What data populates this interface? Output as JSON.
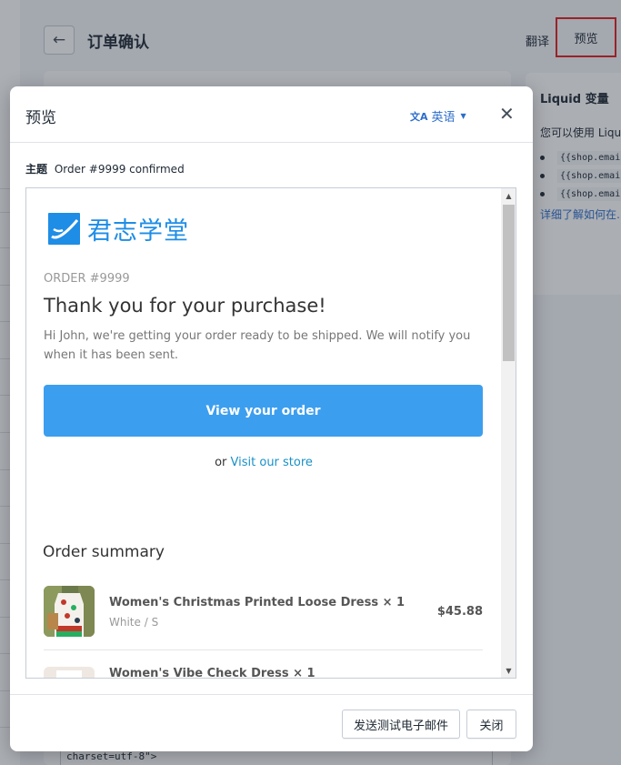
{
  "page": {
    "title": "订单确认",
    "back_icon": "arrow-left-icon",
    "translate_label": "翻译",
    "preview_label": "预览",
    "code_snippet": "charset=utf-8\">"
  },
  "sidebar": {
    "title": "Liquid 变量",
    "description": "您可以使用 Liqu… 强调色和 logo 图… 有:",
    "variables": [
      "{{shop.email",
      "{{shop.email",
      "{{shop.email"
    ],
    "learn_more": "详细了解如何在… Liquid 变量"
  },
  "modal": {
    "title": "预览",
    "language": "英语",
    "subject_label": "主题",
    "subject_value": "Order #9999 confirmed",
    "send_test_label": "发送测试电子邮件",
    "close_label": "关闭"
  },
  "email": {
    "brand_name": "君志学堂",
    "brand_color": "#1e8de6",
    "order_number": "ORDER #9999",
    "heading": "Thank you for your purchase!",
    "intro": "Hi John, we're getting your order ready to be shipped. We will notify you when it has been sent.",
    "cta_label": "View your order",
    "cta_color": "#3c9eef",
    "or_text": "or",
    "visit_store_label": "Visit our store",
    "summary_title": "Order summary",
    "items": [
      {
        "name": "Women's Christmas Printed Loose Dress × 1",
        "variant": "White / S",
        "price": "$45.88"
      },
      {
        "name": "Women's Vibe Check Dress × 1",
        "variant": "",
        "price": ""
      }
    ]
  }
}
